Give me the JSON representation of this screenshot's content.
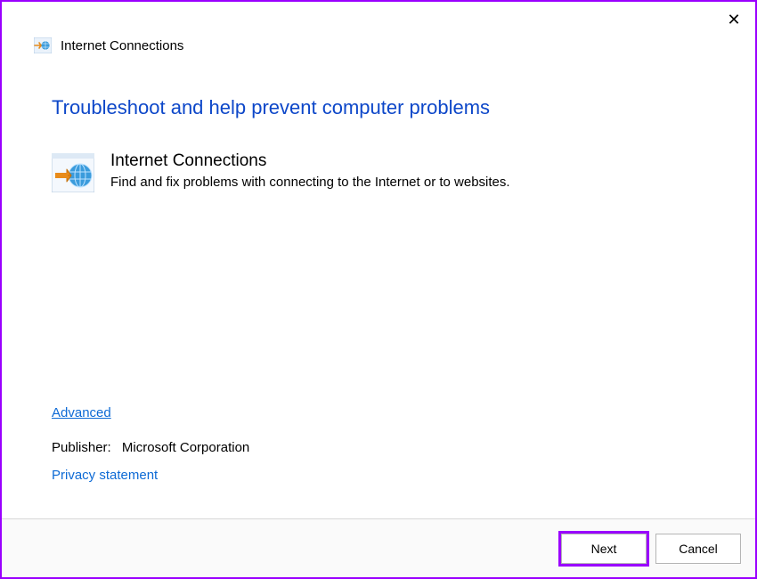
{
  "header": {
    "title": "Internet Connections"
  },
  "main": {
    "heading": "Troubleshoot and help prevent computer problems",
    "section_title": "Internet Connections",
    "section_desc": "Find and fix problems with connecting to the Internet or to websites."
  },
  "links": {
    "advanced": "Advanced",
    "privacy": "Privacy statement"
  },
  "publisher": {
    "label": "Publisher:",
    "value": "Microsoft Corporation"
  },
  "footer": {
    "next": "Next",
    "cancel": "Cancel"
  },
  "icons": {
    "close": "✕"
  }
}
